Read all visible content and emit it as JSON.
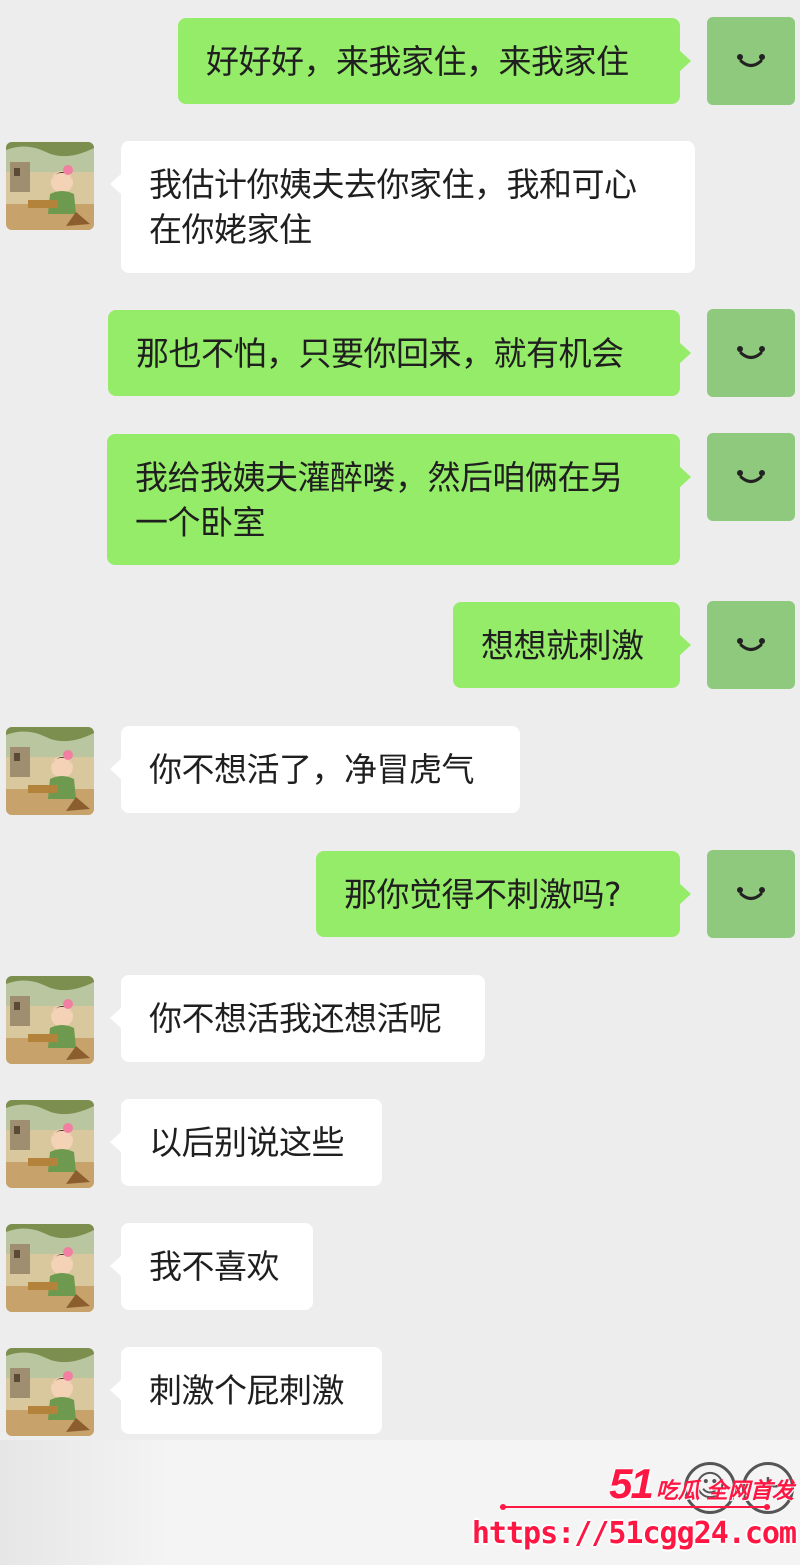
{
  "conversation": {
    "messages": [
      {
        "side": "out",
        "text": "好好好，来我家住，来我家住"
      },
      {
        "side": "in",
        "text": "我估计你姨夫去你家住，我和可心在你姥家住"
      },
      {
        "side": "out",
        "text": "那也不怕，只要你回来，就有机会"
      },
      {
        "side": "out",
        "text": "我给我姨夫灌醉喽，然后咱俩在另一个卧室"
      },
      {
        "side": "out",
        "text": "想想就刺激"
      },
      {
        "side": "in",
        "text": "你不想活了，净冒虎气"
      },
      {
        "side": "out",
        "text": "那你觉得不刺激吗?"
      },
      {
        "side": "in",
        "text": "你不想活我还想活呢"
      },
      {
        "side": "in",
        "text": "以后别说这些"
      },
      {
        "side": "in",
        "text": "我不喜欢"
      },
      {
        "side": "in",
        "text": "刺激个屁刺激"
      }
    ]
  },
  "input_bar": {
    "emoji_icon": "emoji-icon",
    "plus_icon": "plus-icon"
  },
  "watermark": {
    "logo_number": "51",
    "logo_tag": "吃瓜 全网首发",
    "url": "https://51cgg24.com"
  },
  "colors": {
    "background": "#ededed",
    "bubble_out": "#95ec69",
    "bubble_in": "#ffffff",
    "avatar_me": "#8fc97d",
    "watermark": "#ff1744"
  }
}
